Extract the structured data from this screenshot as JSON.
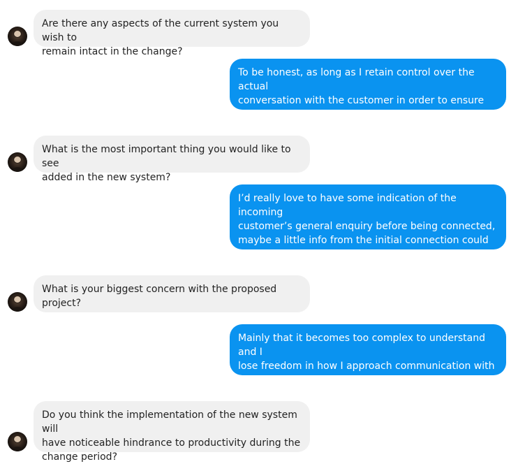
{
  "conversation": {
    "messages": [
      {
        "from": "them",
        "text": "Are there any aspects of the current system you wish to\nremain intact in the change?"
      },
      {
        "from": "me",
        "text": "To be honest, as long as I retain control over the actual\nconversation with the customer in order to ensure sales,\nI’m happy."
      },
      {
        "from": "them",
        "text": "What is the most important thing you would like to see\nadded in the new system?"
      },
      {
        "from": "me",
        "text": "I’d really love to have some indication of the incoming\ncustomer’s general enquiry before being connected,\nmaybe a little info from the initial connection could\nhelp?"
      },
      {
        "from": "them",
        "text": "What is your biggest concern with the proposed\nproject?"
      },
      {
        "from": "me",
        "text": "Mainly that it becomes too complex to understand and I\nlose freedom in how I approach communication with\nthe customer"
      },
      {
        "from": "them",
        "text": "Do you think the implementation of the new system will\nhave noticeable hindrance to productivity during the\nchange period?"
      }
    ]
  },
  "colors": {
    "incoming_bubble": "#f0f0f0",
    "outgoing_bubble": "#0a93f0",
    "incoming_text": "#222222",
    "outgoing_text": "#ffffff"
  },
  "icons": {
    "avatar": "contact-avatar-photo"
  }
}
